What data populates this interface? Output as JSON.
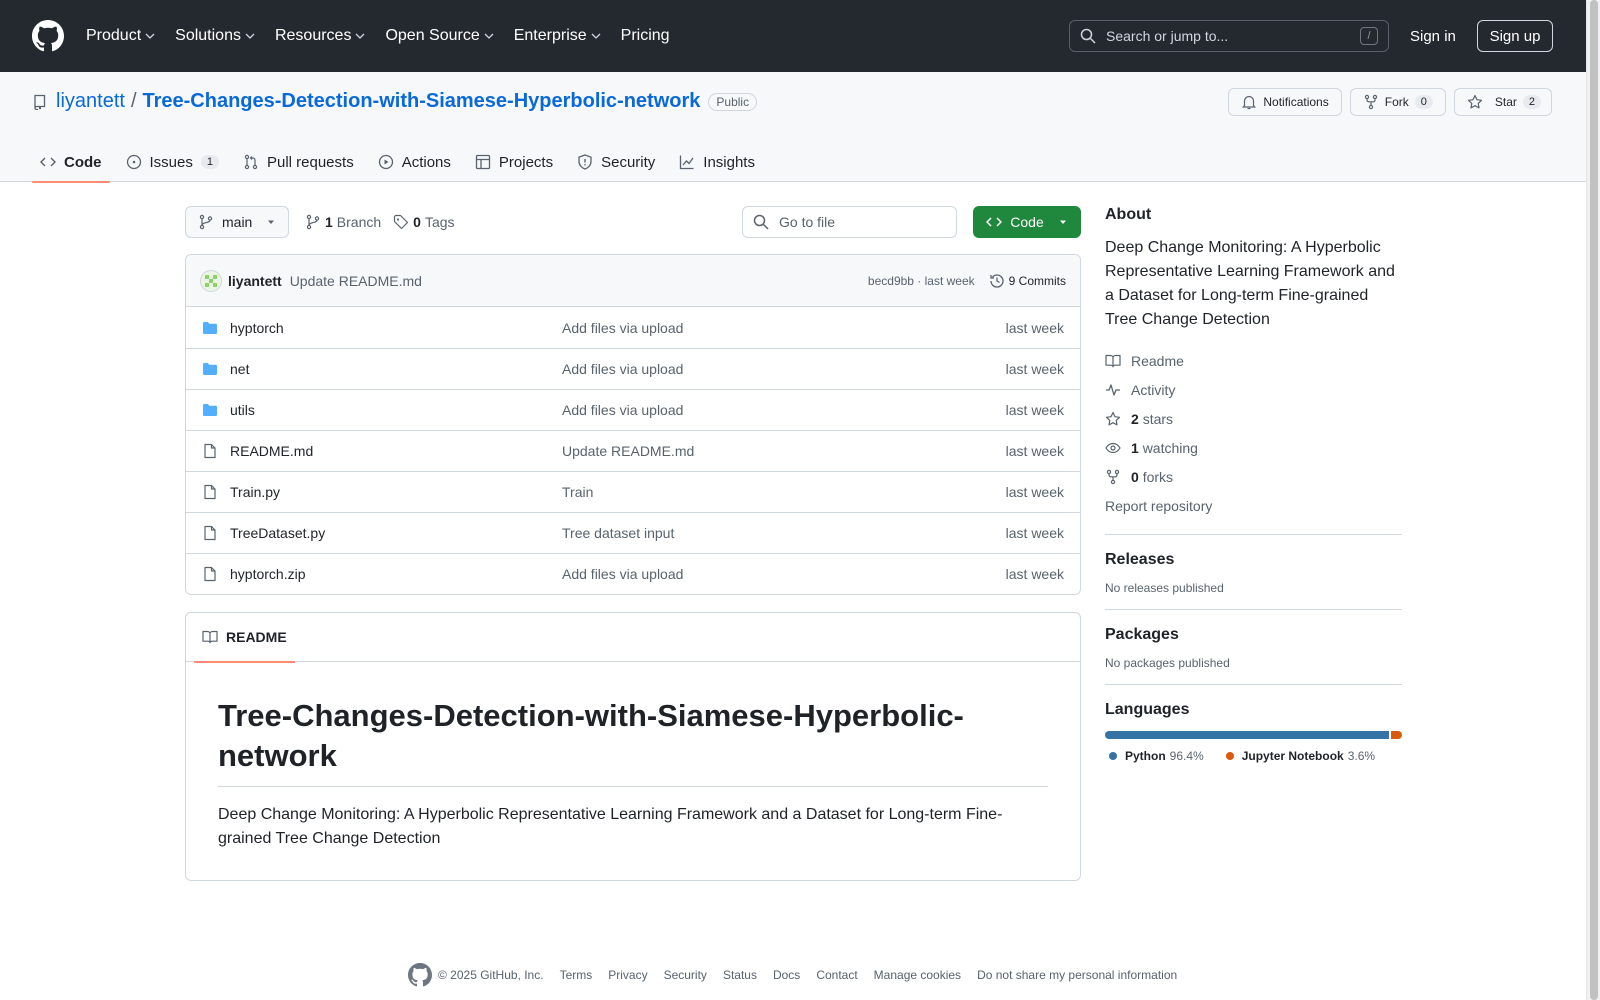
{
  "header": {
    "nav": [
      "Product",
      "Solutions",
      "Resources",
      "Open Source",
      "Enterprise",
      "Pricing"
    ],
    "search_placeholder": "Search or jump to...",
    "search_shortcut": "/",
    "signin": "Sign in",
    "signup": "Sign up"
  },
  "repo": {
    "owner": "liyantett",
    "separator": "/",
    "name": "Tree-Changes-Detection-with-Siamese-Hyperbolic-network",
    "visibility": "Public",
    "notifications": "Notifications",
    "fork_label": "Fork",
    "fork_count": "0",
    "star_label": "Star",
    "star_count": "2"
  },
  "tabs": [
    {
      "label": "Code",
      "count": ""
    },
    {
      "label": "Issues",
      "count": "1"
    },
    {
      "label": "Pull requests",
      "count": ""
    },
    {
      "label": "Actions",
      "count": ""
    },
    {
      "label": "Projects",
      "count": ""
    },
    {
      "label": "Security",
      "count": ""
    },
    {
      "label": "Insights",
      "count": ""
    }
  ],
  "toolbar": {
    "branch": "main",
    "branch_count": "1",
    "branch_label": "Branch",
    "tag_count": "0",
    "tag_label": "Tags",
    "gofile": "Go to file",
    "code_button": "Code"
  },
  "commit": {
    "author": "liyantett",
    "message": "Update README.md",
    "hash_time": "becd9bb · last week",
    "commits": "9 Commits"
  },
  "files": [
    {
      "type": "dir",
      "name": "hyptorch",
      "message": "Add files via upload",
      "date": "last week"
    },
    {
      "type": "dir",
      "name": "net",
      "message": "Add files via upload",
      "date": "last week"
    },
    {
      "type": "dir",
      "name": "utils",
      "message": "Add files via upload",
      "date": "last week"
    },
    {
      "type": "file",
      "name": "README.md",
      "message": "Update README.md",
      "date": "last week"
    },
    {
      "type": "file",
      "name": "Train.py",
      "message": "Train",
      "date": "last week"
    },
    {
      "type": "file",
      "name": "TreeDataset.py",
      "message": "Tree dataset input",
      "date": "last week"
    },
    {
      "type": "file",
      "name": "hyptorch.zip",
      "message": "Add files via upload",
      "date": "last week"
    }
  ],
  "readme": {
    "tab": "README",
    "title": "Tree-Changes-Detection-with-Siamese-Hyperbolic-network",
    "body": "Deep Change Monitoring: A Hyperbolic Representative Learning Framework and a Dataset for Long-term Fine-grained Tree Change Detection"
  },
  "about": {
    "heading": "About",
    "description": "Deep Change Monitoring: A Hyperbolic Representative Learning Framework and a Dataset for Long-term Fine-grained Tree Change Detection",
    "readme": "Readme",
    "activity": "Activity",
    "stars_count": "2",
    "stars_label": "stars",
    "watching_count": "1",
    "watching_label": "watching",
    "forks_count": "0",
    "forks_label": "forks",
    "report": "Report repository"
  },
  "releases": {
    "heading": "Releases",
    "text": "No releases published"
  },
  "packages": {
    "heading": "Packages",
    "text": "No packages published"
  },
  "languages": {
    "heading": "Languages",
    "items": [
      {
        "name": "Python",
        "percent": "96.4%",
        "value": 96.4,
        "color": "#3572A5"
      },
      {
        "name": "Jupyter Notebook",
        "percent": "3.6%",
        "value": 3.6,
        "color": "#DA5B0B"
      }
    ]
  },
  "footer": {
    "copyright": "© 2025 GitHub, Inc.",
    "links": [
      "Terms",
      "Privacy",
      "Security",
      "Status",
      "Docs",
      "Contact",
      "Manage cookies",
      "Do not share my personal information"
    ]
  }
}
